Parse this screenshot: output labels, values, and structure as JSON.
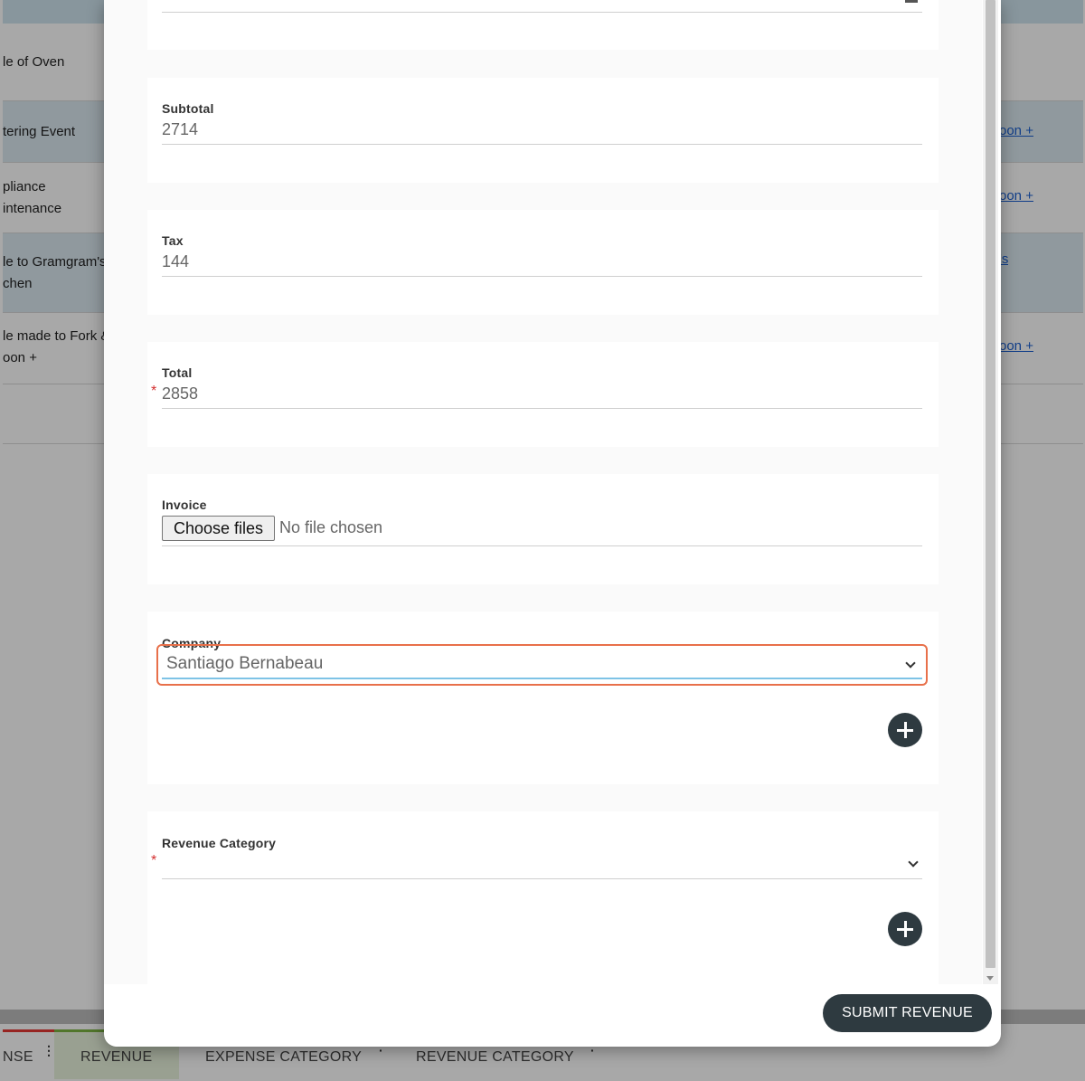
{
  "background": {
    "rows": [
      {
        "lines": [
          "le of Oven"
        ],
        "link": ""
      },
      {
        "lines": [
          "tering Event"
        ],
        "link": "oon +"
      },
      {
        "lines": [
          "pliance",
          "intenance"
        ],
        "link": "oon +"
      },
      {
        "lines": [
          "le to Gramgram's",
          "chen"
        ],
        "link": "'s"
      },
      {
        "lines": [
          "le made to Fork &",
          "oon +"
        ],
        "link": "oon +"
      }
    ],
    "tabs": {
      "expense": "NSE",
      "revenue": "REVENUE",
      "expense_category": "EXPENSE CATEGORY",
      "revenue_category": "REVENUE CATEGORY"
    }
  },
  "modal": {
    "subtotal": {
      "label": "Subtotal",
      "value": "2714"
    },
    "tax": {
      "label": "Tax",
      "value": "144"
    },
    "total": {
      "label": "Total",
      "value": "2858",
      "required_mark": "*"
    },
    "invoice": {
      "label": "Invoice",
      "button": "Choose files",
      "status": "No file chosen"
    },
    "company": {
      "label": "Company",
      "value": "Santiago Bernabeau"
    },
    "revenue_category": {
      "label": "Revenue Category",
      "value": "",
      "required_mark": "*"
    },
    "submit_label": "SUBMIT REVENUE"
  },
  "colors": {
    "accent_dark": "#2e3a40",
    "focus_outline": "#e8704a",
    "focus_underline": "#7ec3e6",
    "required": "#d32f2f",
    "link": "#1a5fd0"
  }
}
